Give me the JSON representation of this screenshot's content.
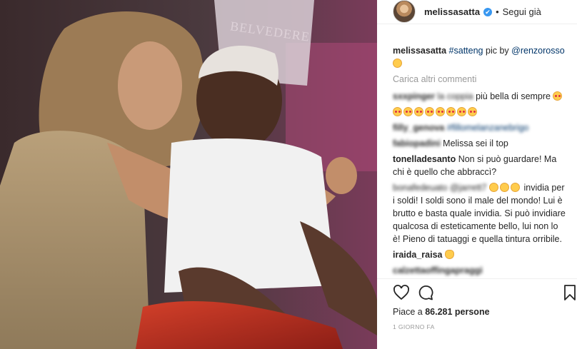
{
  "photo": {
    "alt": "",
    "watermark": "BELVEDERE"
  },
  "header": {
    "username": "melissasatta",
    "verified_icon": "✔",
    "separator": "•",
    "follow_state": "Segui già"
  },
  "caption": {
    "username": "melissasatta",
    "hashtag": "#satteng",
    "text": "pic by",
    "mention": "@renzorosso"
  },
  "load_more": "Carica altri commenti",
  "comments": [
    {
      "user": "sxxpinger",
      "text_blur": "la coppia",
      "text": "più bella di sempre"
    },
    {
      "user": "filly_genova",
      "text_blur": "#fillomelanzanebrigo",
      "text": ""
    },
    {
      "user": "fabiopadini",
      "text": "Melissa sei il top"
    },
    {
      "user": "tonelladesanto",
      "text": "Non si può guardare! Ma chi è quello che abbraccì?"
    },
    {
      "user": "bonafede",
      "text_blur": "bonafedeuato @jarrett7",
      "text": "invidia per i soldi! I soldi sono il male del mondo! Lui è brutto e basta quale invidia. Si può invidiare qualcosa di esteticamente bello, lui non lo è! Pieno di tatuaggi e quella tintura orribile."
    },
    {
      "user": "iraida_raisa",
      "text": ""
    },
    {
      "user": "calzetta",
      "text_blur": "calzettaoffingapraggi",
      "text": ""
    }
  ],
  "likes": {
    "prefix": "Piace a",
    "count": "86.281",
    "suffix": "persone"
  },
  "date": "1 GIORNO FA",
  "colors": {
    "accent_link": "#003569",
    "verified": "#3897f0",
    "muted": "#999999"
  },
  "icons": [
    "heart-icon",
    "comment-icon",
    "bookmark-icon",
    "verified-icon"
  ]
}
